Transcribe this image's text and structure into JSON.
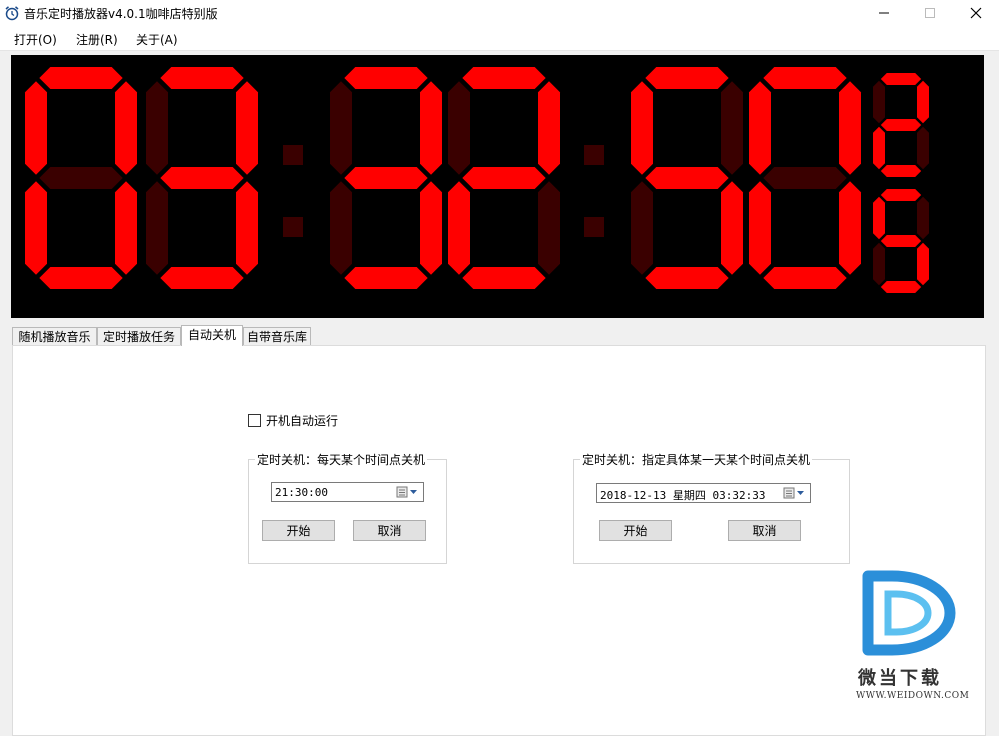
{
  "window": {
    "title": "音乐定时播放器v4.0.1咖啡店特别版"
  },
  "menu": {
    "items": [
      "打开(O)",
      "注册(R)",
      "关于(A)"
    ]
  },
  "clock": {
    "time": "03:32:50",
    "seconds_digits": "25",
    "segment_on_color": "#ff0000",
    "segment_off_color": "#3a0000",
    "background": "#000000"
  },
  "tabs": [
    {
      "label": "随机播放音乐",
      "active": false
    },
    {
      "label": "定时播放任务",
      "active": false
    },
    {
      "label": "自动关机",
      "active": true
    },
    {
      "label": "自带音乐库",
      "active": false
    }
  ],
  "auto_shutdown": {
    "startup_checkbox": {
      "label": "开机自动运行",
      "checked": false
    },
    "daily": {
      "title": "定时关机：每天某个时间点关机",
      "time_value": "21:30:00",
      "start_label": "开始",
      "cancel_label": "取消"
    },
    "specific": {
      "title": "定时关机：指定具体某一天某个时间点关机",
      "datetime_value": "2018-12-13 星期四 03:32:33",
      "start_label": "开始",
      "cancel_label": "取消"
    }
  },
  "watermark": {
    "name": "微当下载",
    "url": "WWW.WEIDOWN.COM",
    "color": "#2b8fd9"
  }
}
